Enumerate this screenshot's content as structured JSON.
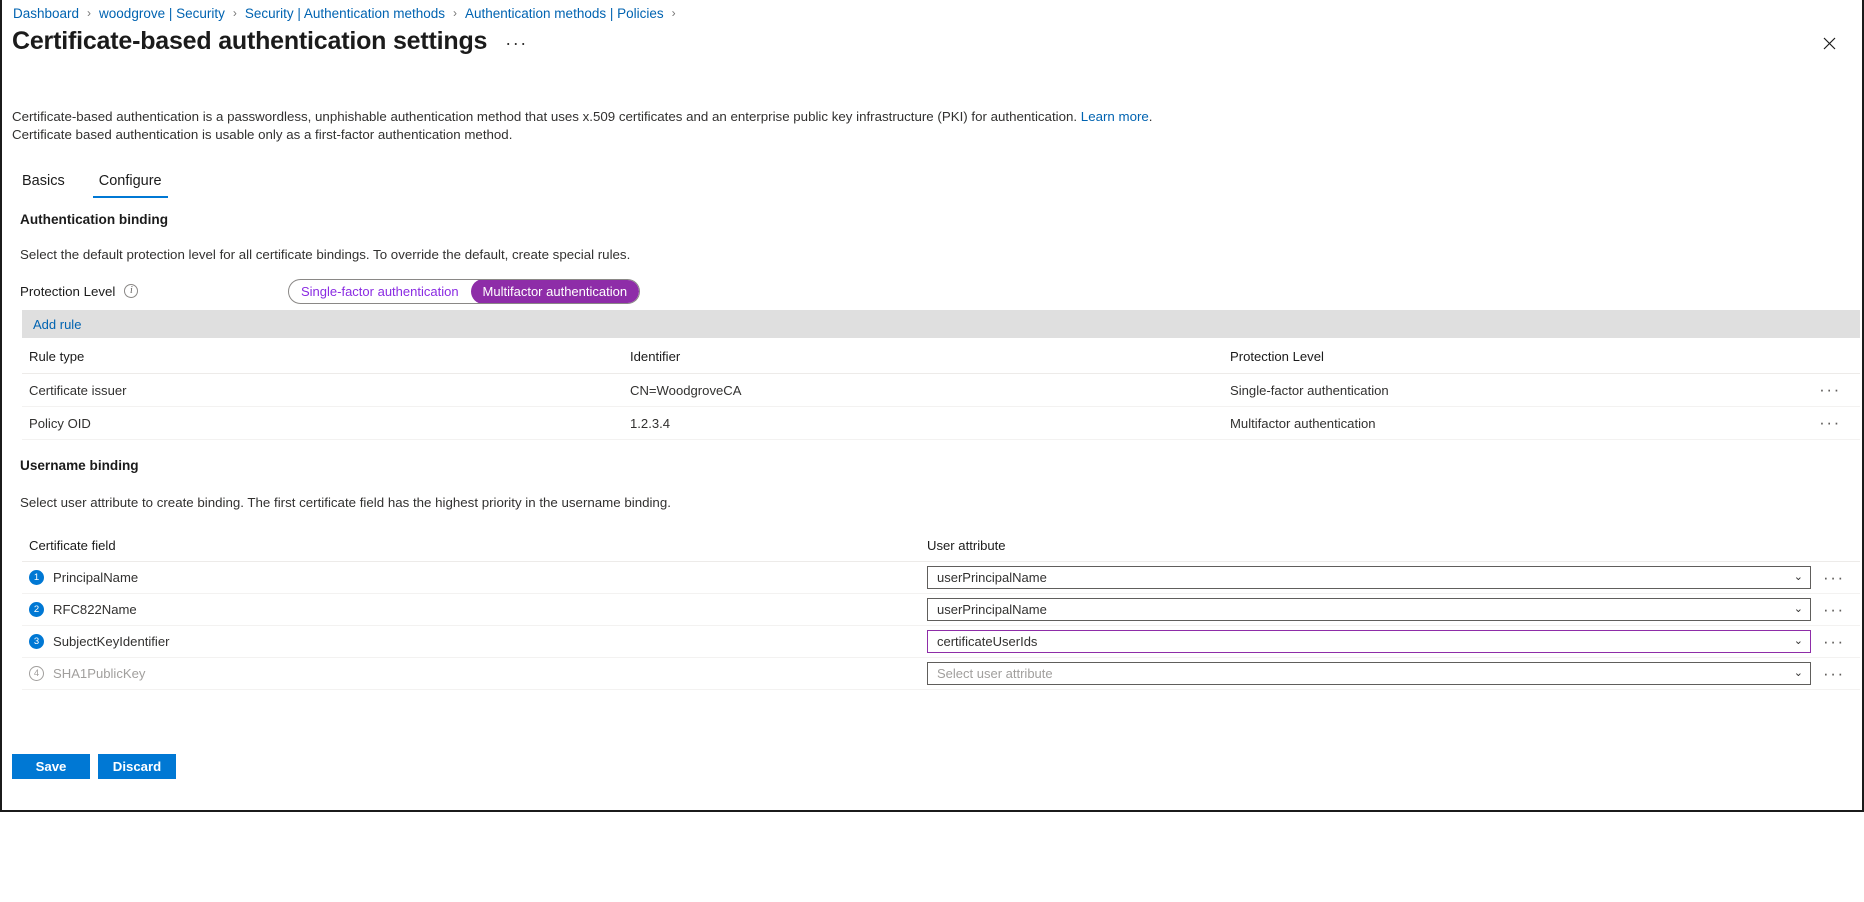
{
  "breadcrumb": {
    "separator": "›",
    "items": [
      {
        "label": "Dashboard"
      },
      {
        "label": "woodgrove | Security"
      },
      {
        "label": "Security | Authentication methods"
      },
      {
        "label": "Authentication methods | Policies"
      }
    ]
  },
  "header": {
    "title": "Certificate-based authentication settings",
    "ellipsis": "···",
    "close_icon": "close-icon"
  },
  "description": {
    "line1_before_link": "Certificate-based authentication is a passwordless, unphishable authentication method that uses x.509 certificates and an enterprise public key infrastructure (PKI) for authentication. ",
    "link_label": "Learn more",
    "line1_after_link": ".",
    "line2": "Certificate based authentication is usable only as a first-factor authentication method."
  },
  "tabs": [
    {
      "label": "Basics",
      "active": false
    },
    {
      "label": "Configure",
      "active": true
    }
  ],
  "authentication_binding": {
    "heading": "Authentication binding",
    "description": "Select the default protection level for all certificate bindings. To override the default, create special rules.",
    "protection_level": {
      "label": "Protection Level",
      "info_glyph": "i",
      "options": [
        {
          "label": "Single-factor authentication",
          "selected": false
        },
        {
          "label": "Multifactor authentication",
          "selected": true
        }
      ],
      "accent_color": "#8e2da8"
    },
    "command_bar": {
      "add_rule_label": "Add rule"
    },
    "table": {
      "columns": [
        "Rule type",
        "Identifier",
        "Protection Level"
      ],
      "rows": [
        {
          "rule_type": "Certificate issuer",
          "identifier": "CN=WoodgroveCA",
          "protection_level": "Single-factor authentication",
          "actions": "···"
        },
        {
          "rule_type": "Policy OID",
          "identifier": "1.2.3.4",
          "protection_level": "Multifactor authentication",
          "actions": "···"
        }
      ]
    }
  },
  "username_binding": {
    "heading": "Username binding",
    "description": "Select user attribute to create binding. The first certificate field has the highest priority in the username binding.",
    "columns": [
      "Certificate field",
      "User attribute"
    ],
    "rows": [
      {
        "order": "1",
        "certificate_field": "PrincipalName",
        "user_attribute": "userPrincipalName",
        "placeholder": "Select user attribute",
        "disabled": false,
        "focused": false,
        "chevron": "chevron-down-icon",
        "actions": "···"
      },
      {
        "order": "2",
        "certificate_field": "RFC822Name",
        "user_attribute": "userPrincipalName",
        "placeholder": "Select user attribute",
        "disabled": false,
        "focused": false,
        "chevron": "chevron-down-icon",
        "actions": "···"
      },
      {
        "order": "3",
        "certificate_field": "SubjectKeyIdentifier",
        "user_attribute": "certificateUserIds",
        "placeholder": "Select user attribute",
        "disabled": false,
        "focused": true,
        "chevron": "chevron-down-icon",
        "actions": "···"
      },
      {
        "order": "4",
        "certificate_field": "SHA1PublicKey",
        "user_attribute": "",
        "placeholder": "Select user attribute",
        "disabled": true,
        "focused": false,
        "chevron": "chevron-down-icon",
        "actions": "···"
      }
    ]
  },
  "footer": {
    "save_label": "Save",
    "discard_label": "Discard",
    "primary_color": "#0078d4"
  }
}
